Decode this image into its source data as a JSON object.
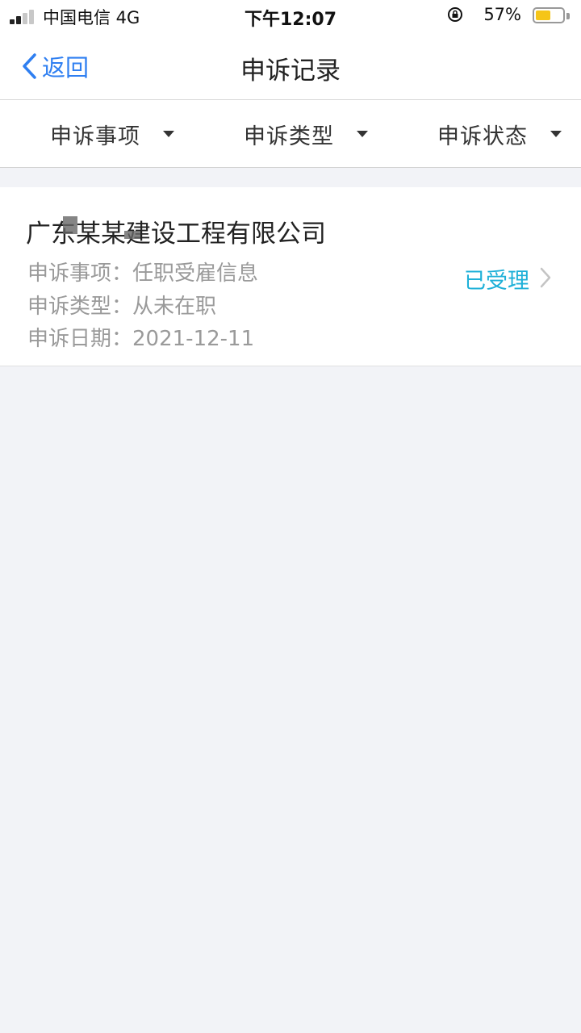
{
  "status_bar": {
    "carrier": "中国电信  4G",
    "time": "下午12:07",
    "battery_percent": "57%",
    "battery_level": 0.57
  },
  "nav": {
    "back_label": "返回",
    "title": "申诉记录"
  },
  "filters": [
    {
      "label": "申诉事项"
    },
    {
      "label": "申诉类型"
    },
    {
      "label": "申诉状态"
    }
  ],
  "records": [
    {
      "company": "广东某某建设工程有限公司",
      "matter_label": "申诉事项：",
      "matter": "任职受雇信息",
      "type_label": "申诉类型：",
      "type": "从未在职",
      "date_label": "申诉日期：",
      "date": "2021-12-11",
      "status": "已受理"
    }
  ],
  "colors": {
    "accent": "#2f7ff1",
    "status": "#1eb0d8",
    "background": "#f2f3f7"
  }
}
